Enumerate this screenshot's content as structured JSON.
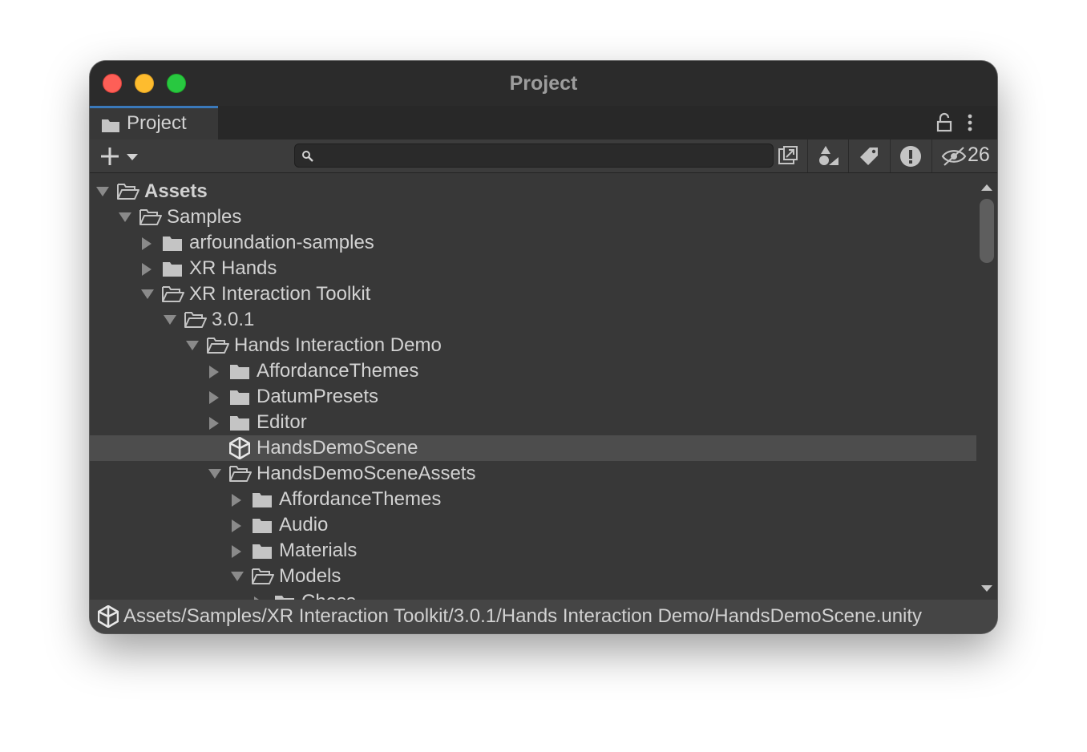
{
  "window": {
    "title": "Project"
  },
  "tabs": [
    {
      "label": "Project",
      "icon": "folder-icon"
    }
  ],
  "toolbar": {
    "search": {
      "value": "",
      "placeholder": ""
    },
    "hidden_packages_count": "26"
  },
  "tree": [
    {
      "label": "Assets",
      "depth": 0,
      "expanded": true,
      "icon": "folder-open-icon",
      "bold": true
    },
    {
      "label": "Samples",
      "depth": 1,
      "expanded": true,
      "icon": "folder-open-icon"
    },
    {
      "label": "arfoundation-samples",
      "depth": 2,
      "expanded": false,
      "icon": "folder-icon"
    },
    {
      "label": "XR Hands",
      "depth": 2,
      "expanded": false,
      "icon": "folder-icon"
    },
    {
      "label": "XR Interaction Toolkit",
      "depth": 2,
      "expanded": true,
      "icon": "folder-open-icon"
    },
    {
      "label": "3.0.1",
      "depth": 3,
      "expanded": true,
      "icon": "folder-open-icon"
    },
    {
      "label": "Hands Interaction Demo",
      "depth": 4,
      "expanded": true,
      "icon": "folder-open-icon"
    },
    {
      "label": "AffordanceThemes",
      "depth": 5,
      "expanded": false,
      "icon": "folder-icon"
    },
    {
      "label": "DatumPresets",
      "depth": 5,
      "expanded": false,
      "icon": "folder-icon"
    },
    {
      "label": "Editor",
      "depth": 5,
      "expanded": false,
      "icon": "folder-icon"
    },
    {
      "label": "HandsDemoScene",
      "depth": 5,
      "expanded": null,
      "icon": "unity-scene-icon",
      "selected": true
    },
    {
      "label": "HandsDemoSceneAssets",
      "depth": 5,
      "expanded": true,
      "icon": "folder-open-icon"
    },
    {
      "label": "AffordanceThemes",
      "depth": 6,
      "expanded": false,
      "icon": "folder-icon"
    },
    {
      "label": "Audio",
      "depth": 6,
      "expanded": false,
      "icon": "folder-icon"
    },
    {
      "label": "Materials",
      "depth": 6,
      "expanded": false,
      "icon": "folder-icon"
    },
    {
      "label": "Models",
      "depth": 6,
      "expanded": true,
      "icon": "folder-open-icon"
    },
    {
      "label": "Chess",
      "depth": 7,
      "expanded": false,
      "icon": "folder-icon"
    }
  ],
  "status": {
    "path": "Assets/Samples/XR Interaction Toolkit/3.0.1/Hands Interaction Demo/HandsDemoScene.unity",
    "icon": "unity-scene-icon"
  },
  "colors": {
    "close": "#fe5f57",
    "minimize": "#febc2e",
    "zoom": "#28c840",
    "tab_accent": "#3a79bb",
    "selection": "#4d4d4d"
  }
}
